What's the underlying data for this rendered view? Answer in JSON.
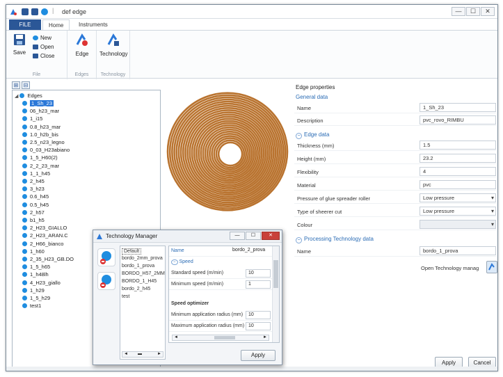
{
  "window": {
    "title": "def edge",
    "controls": [
      "—",
      "☐",
      "✕"
    ]
  },
  "ribbon_tabs": {
    "file": "FILE",
    "home": "Home",
    "tools": "Instruments"
  },
  "ribbon": {
    "file_group": {
      "save": "Save",
      "new": "New",
      "open": "Open",
      "close": "Close",
      "label": "File"
    },
    "edges_group": {
      "edge": "Edge",
      "label": "Edges"
    },
    "tech_group": {
      "technology": "Technology",
      "label": "Technology"
    }
  },
  "tree": {
    "root": "Edges",
    "items": [
      "1_Sh_23",
      "06_h23_mar",
      "1_i15",
      "0.8_h23_mar",
      "1.0_h2b_bis",
      "2.5_n23_legno",
      "0_03_H23abiano",
      "1_5_H60(2)",
      "2_2_23_mar",
      "1_1_h45",
      "2_h45",
      "3_h23",
      "0.6_h45",
      "0.5_h45",
      "2_h57",
      "b1_h5",
      "2_H23_GIALLO",
      "2_H23_ARAN.C",
      "2_H66_bianco",
      "1_h60",
      "2_35_H23_GB.DO",
      "1_5_h65",
      "1_h48lh",
      "4_H23_giallo",
      "1_h29",
      "1_5_h29",
      "test1"
    ],
    "selected_index": 0
  },
  "properties": {
    "header": "Edge properties",
    "general_section": "General data",
    "general_rows": [
      {
        "label": "Name",
        "value": "1_Sh_23"
      },
      {
        "label": "Description",
        "value": "pvc_rovo_RIMBU"
      }
    ],
    "edge_section": "Edge data",
    "edge_rows": [
      {
        "label": "Thickness (mm)",
        "value": "1.5",
        "dropdown": false
      },
      {
        "label": "Height (mm)",
        "value": "23.2",
        "dropdown": false
      },
      {
        "label": "Flexibility",
        "value": "4",
        "dropdown": false
      },
      {
        "label": "Material",
        "value": "pvc",
        "dropdown": false
      },
      {
        "label": "Pressure of glue spreader roller",
        "value": "Low pressure",
        "dropdown": true
      },
      {
        "label": "Type of sheerer cut",
        "value": "Low pressure",
        "dropdown": true
      },
      {
        "label": "Colour",
        "value": "",
        "dropdown": true
      }
    ],
    "proc_section": "Processing Technology data",
    "proc_rows": [
      {
        "label": "Name",
        "value": "bordo_1_prova"
      }
    ],
    "open_tm_label": "Open Technology manag"
  },
  "footer": {
    "apply": "Apply",
    "cancel": "Cancel"
  },
  "dialog": {
    "title": "Technology Manager",
    "list": [
      "Default",
      "bordo_2mm_prova",
      "bordo_1_prova",
      "BORDO_H57_2MM",
      "BORDO_1_H45",
      "bordo_2_h45",
      "test"
    ],
    "selected_index": 0,
    "grid": {
      "name_label": "Name",
      "name_value": "bordo_2_prova",
      "speed_section": "Speed",
      "rows": [
        {
          "label": "Standard speed (m/min)",
          "value": "10"
        },
        {
          "label": "Minimum speed (m/min)",
          "value": "1"
        }
      ],
      "optimizer_label": "Speed optimizer",
      "opt_rows": [
        {
          "label": "Minimum application radius (mm)",
          "value": "10"
        },
        {
          "label": "Maximum application radius (mm)",
          "value": "10"
        }
      ]
    },
    "apply": "Apply",
    "nav": {
      "left": "◄",
      "middle": "▬",
      "right": "►"
    }
  },
  "colors": {
    "accent": "#2b5797",
    "selection": "#2b78d8",
    "node": "#1f8de0",
    "tape": "#c47a3a"
  }
}
